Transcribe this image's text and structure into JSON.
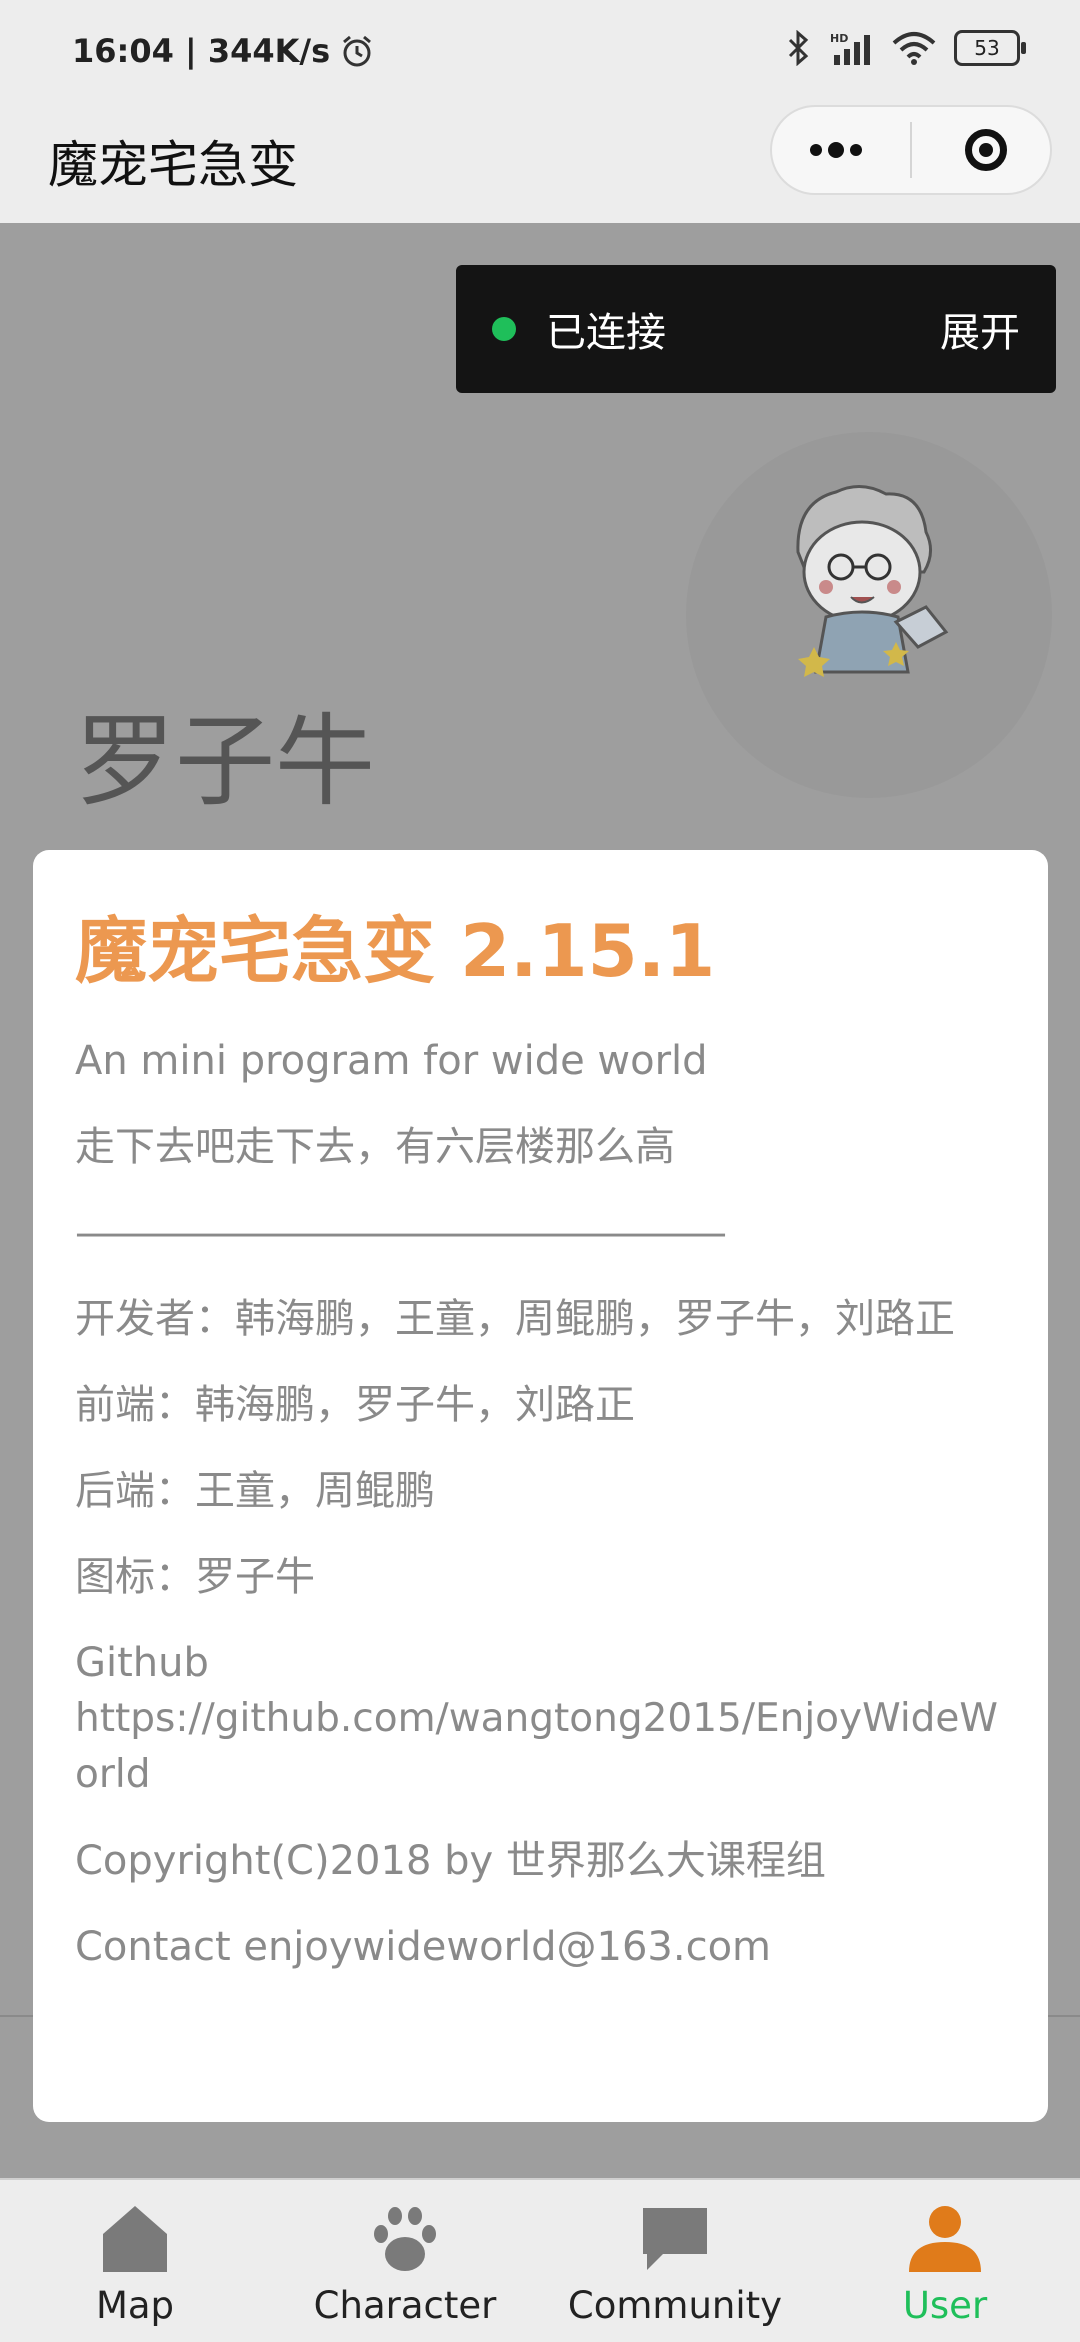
{
  "status_bar": {
    "time_speed": "16:04 | 344K/s",
    "battery": "53",
    "network": "HD"
  },
  "nav": {
    "title": "魔宠宅急变",
    "more_icon": "more-dots-icon",
    "close_icon": "target-icon"
  },
  "connection": {
    "status": "已连接",
    "expand": "展开",
    "dot_color": "#1fbf5a"
  },
  "profile": {
    "name": "罗子牛"
  },
  "about": {
    "title": "魔宠宅急变 2.15.1",
    "lines": [
      "An mini program for wide world",
      "走下去吧走下去，有六层楼那么高",
      "——————————————————",
      "开发者：韩海鹏，王童，周鲲鹏，罗子牛，刘路正",
      "前端：韩海鹏，罗子牛，刘路正",
      "后端：王童，周鲲鹏",
      "图标：罗子牛"
    ],
    "github_label": "Github",
    "github_url": "https://github.com/wangtong2015/EnjoyWideWorld",
    "copyright": "Copyright(C)2018 by 世界那么大课程组",
    "contact": "Contact enjoywideworld@163.com",
    "title_color": "#ec9850"
  },
  "tabs": [
    {
      "label": "Map",
      "icon": "house-icon"
    },
    {
      "label": "Character",
      "icon": "paw-icon"
    },
    {
      "label": "Community",
      "icon": "chat-bubble-icon"
    },
    {
      "label": "User",
      "icon": "user-icon",
      "active": true
    }
  ],
  "colors": {
    "active_tab": "#1fbf5a",
    "user_icon": "#e07b1a",
    "inactive_icon": "#7a7a7a"
  }
}
